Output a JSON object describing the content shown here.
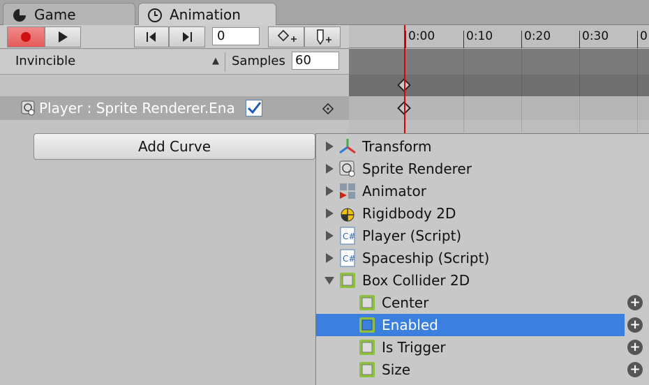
{
  "tabs": [
    {
      "label": "Game",
      "icon": "pacman-icon",
      "active": false
    },
    {
      "label": "Animation",
      "icon": "clock-icon",
      "active": true
    }
  ],
  "toolbar": {
    "record_icon": "record-icon",
    "play_icon": "play-icon",
    "prev_key_icon": "previous-keyframe-icon",
    "next_key_icon": "next-keyframe-icon",
    "frame_value": "0",
    "add_key_icon": "add-keyframe-icon",
    "add_event_icon": "add-event-icon",
    "record_color": "#e65a5a"
  },
  "clip": {
    "selected": "Invincible",
    "samples_label": "Samples",
    "samples_value": "60"
  },
  "timeline": {
    "ticks": [
      "0:00",
      "0:10",
      "0:20",
      "0:30",
      "0"
    ],
    "playhead_color": "#e00000"
  },
  "property": {
    "label": "Player : Sprite Renderer.Ena",
    "checked": true
  },
  "add_curve_label": "Add Curve",
  "menu": {
    "items": [
      {
        "label": "Transform",
        "icon": "transform-icon",
        "expand": "right"
      },
      {
        "label": "Sprite Renderer",
        "icon": "sprite-renderer-icon",
        "expand": "right"
      },
      {
        "label": "Animator",
        "icon": "animator-icon",
        "expand": "right"
      },
      {
        "label": "Rigidbody 2D",
        "icon": "rigidbody-icon",
        "expand": "right"
      },
      {
        "label": "Player (Script)",
        "icon": "csharp-script-icon",
        "expand": "right"
      },
      {
        "label": "Spaceship (Script)",
        "icon": "csharp-script-icon",
        "expand": "right"
      },
      {
        "label": "Box Collider 2D",
        "icon": "box-collider-icon",
        "expand": "down"
      }
    ],
    "subitems": [
      {
        "label": "Center",
        "selected": false
      },
      {
        "label": "Enabled",
        "selected": true
      },
      {
        "label": "Is Trigger",
        "selected": false
      },
      {
        "label": "Size",
        "selected": false
      }
    ],
    "selected_color": "#3b7fdf"
  }
}
